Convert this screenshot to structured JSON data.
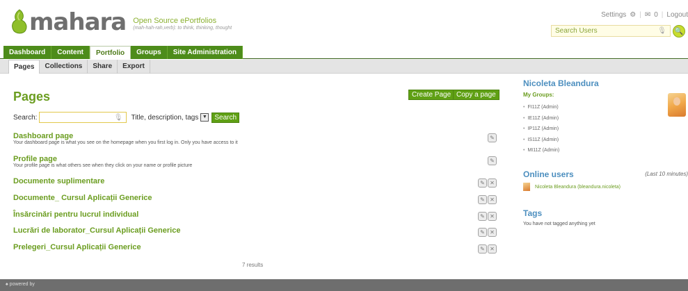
{
  "header": {
    "logo_text": "mahara",
    "tagline": "Open Source ePortfolios",
    "tagline_sub": "(mah-hah-rah,verb): to think, thinking, thought",
    "settings_label": "Settings",
    "inbox_count": "0",
    "logout_label": "Logout",
    "search_users_placeholder": "Search Users"
  },
  "main_nav": {
    "tabs": [
      "Dashboard",
      "Content",
      "Portfolio",
      "Groups",
      "Site Administration"
    ],
    "active": "Portfolio"
  },
  "sub_nav": {
    "tabs": [
      "Pages",
      "Collections",
      "Share",
      "Export"
    ],
    "active": "Pages"
  },
  "content": {
    "title": "Pages",
    "create_page_label": "Create Page",
    "copy_page_label": "Copy a page",
    "search_label": "Search:",
    "search_value": "",
    "search_scope": "Title, description, tags",
    "search_button": "Search",
    "pages": [
      {
        "name": "Dashboard page",
        "desc": "Your dashboard page is what you see on the homepage when you first log in. Only you have access to it"
      },
      {
        "name": "Profile page",
        "desc": "Your profile page is what others see when they click on your name or profile picture"
      },
      {
        "name": "Documente suplimentare",
        "desc": ""
      },
      {
        "name": "Documente_ Cursul Aplicații Generice",
        "desc": ""
      },
      {
        "name": "Însărcinări pentru lucrul individual",
        "desc": ""
      },
      {
        "name": "Lucrări de laborator_Cursul Aplicații Generice",
        "desc": ""
      },
      {
        "name": "Prelegeri_Cursul Aplicații Generice",
        "desc": ""
      }
    ],
    "results_text": "7 results"
  },
  "sidebar": {
    "user_name": "Nicoleta Bleandura",
    "my_groups_label": "My Groups:",
    "groups": [
      "FI11Z (Admin)",
      "IE11Z (Admin)",
      "IP11Z (Admin)",
      "IS11Z (Admin)",
      "MI11Z (Admin)"
    ],
    "online_users_title": "Online users",
    "online_users_period": "(Last 10 minutes)",
    "online_user": "Nicoleta Bleandura (bleandura.nicoleta)",
    "tags_title": "Tags",
    "tags_text": "You have not tagged anything yet"
  },
  "footer": {
    "powered_by": "powered by"
  },
  "colors": {
    "brand_green": "#5fa014",
    "nav_green": "#4d8c1a",
    "heading_green": "#6b9d20",
    "sidebar_blue": "#4d8fbf",
    "footer_gray": "#6e6e6e"
  }
}
